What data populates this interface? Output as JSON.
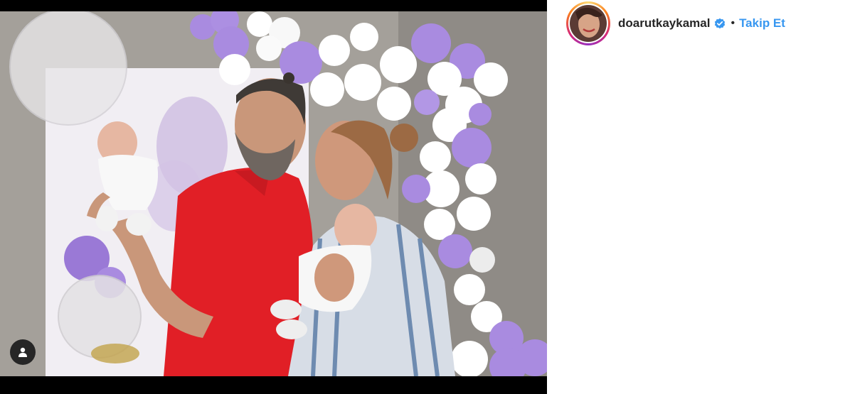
{
  "post": {
    "photo_icon": "family-photo",
    "user_tag_icon": "person-icon"
  },
  "header": {
    "avatar_icon": "profile-avatar",
    "username": "doarutkaykamal",
    "verified_icon": "verified-badge-icon",
    "separator": "•",
    "follow_label": "Takip Et"
  },
  "colors": {
    "follow": "#3897f0",
    "verified": "#3897f0",
    "balloon_purple": "#a98be0",
    "shirt_red": "#e11f26",
    "backdrop": "#a19d97"
  }
}
